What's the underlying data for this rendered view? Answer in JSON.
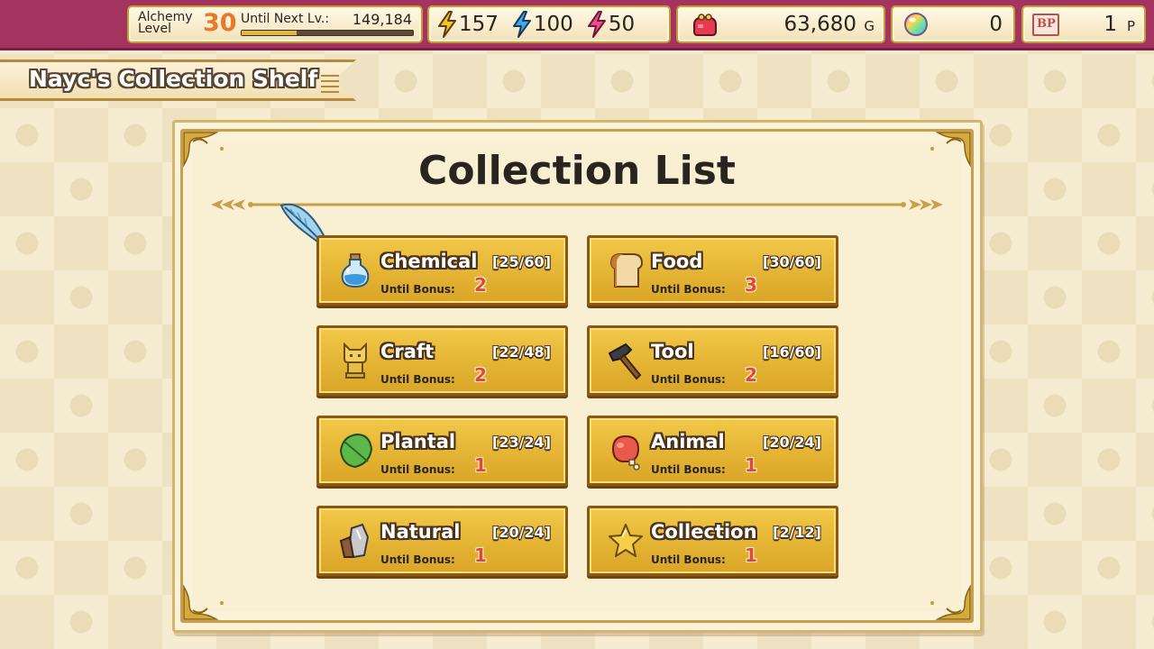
{
  "header": {
    "alchemy_level_label": "Alchemy Level",
    "alchemy_level": "30",
    "next_level_label": "Until Next Lv.:",
    "next_level_value": "149,184",
    "xp_progress": 0.32,
    "stamina": [
      {
        "icon": "lightning-yellow-icon",
        "value": "157",
        "color": "#f0c020"
      },
      {
        "icon": "lightning-blue-icon",
        "value": "100",
        "color": "#35a8e8"
      },
      {
        "icon": "lightning-pink-icon",
        "value": "50",
        "color": "#ee4a8a"
      }
    ],
    "gold_value": "63,680",
    "gold_unit": "G",
    "gem_value": "0",
    "bp_icon_text": "BP",
    "bp_value": "1",
    "bp_unit": "P"
  },
  "ribbon": {
    "title": "Nayc's Collection Shelf"
  },
  "panel": {
    "title": "Collection List"
  },
  "categories": [
    {
      "name": "Chemical",
      "count": "[25/60]",
      "bonus_label": "Until Bonus:",
      "bonus": "2",
      "icon": "potion-icon"
    },
    {
      "name": "Food",
      "count": "[30/60]",
      "bonus_label": "Until Bonus:",
      "bonus": "3",
      "icon": "bread-icon"
    },
    {
      "name": "Craft",
      "count": "[22/48]",
      "bonus_label": "Until Bonus:",
      "bonus": "2",
      "icon": "cat-figurine-icon"
    },
    {
      "name": "Tool",
      "count": "[16/60]",
      "bonus_label": "Until Bonus:",
      "bonus": "2",
      "icon": "hammer-icon"
    },
    {
      "name": "Plantal",
      "count": "[23/24]",
      "bonus_label": "Until Bonus:",
      "bonus": "1",
      "icon": "leaf-icon"
    },
    {
      "name": "Animal",
      "count": "[20/24]",
      "bonus_label": "Until Bonus:",
      "bonus": "1",
      "icon": "meat-icon"
    },
    {
      "name": "Natural",
      "count": "[20/24]",
      "bonus_label": "Until Bonus:",
      "bonus": "1",
      "icon": "stone-icon"
    },
    {
      "name": "Collection",
      "count": "[2/12]",
      "bonus_label": "Until Bonus:",
      "bonus": "1",
      "icon": "star-icon"
    }
  ]
}
